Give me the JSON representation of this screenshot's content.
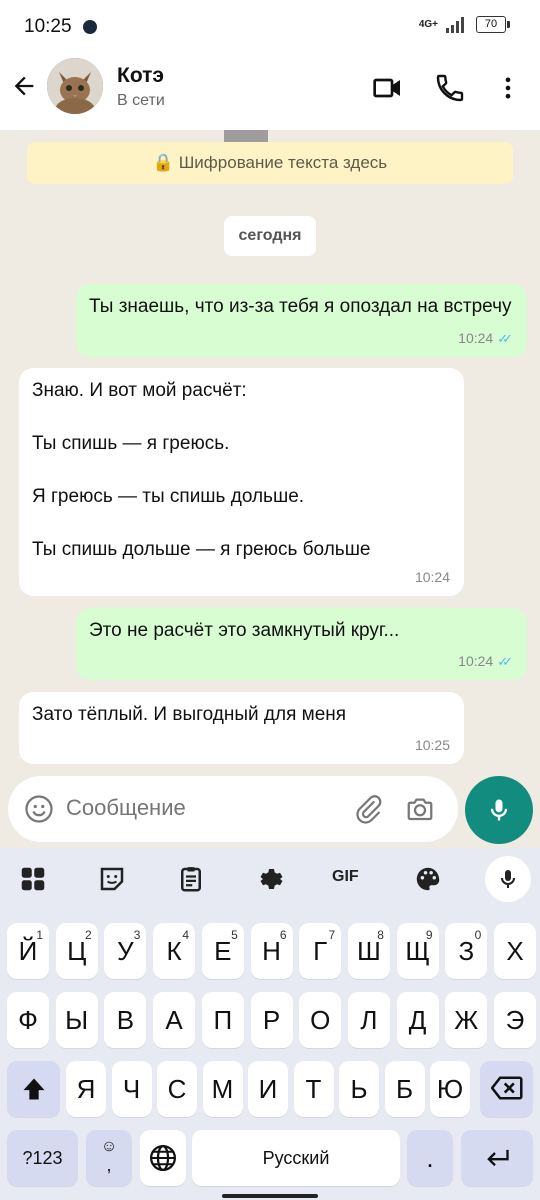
{
  "status_bar": {
    "time": "10:25",
    "network": "4G+",
    "battery": "70"
  },
  "header": {
    "contact_name": "Котэ",
    "contact_status": "В сети"
  },
  "chat": {
    "encryption_note": "🔒 Шифрование текста здесь",
    "date_chip": "сегодня",
    "messages": [
      {
        "direction": "out",
        "text": "Ты знаешь, что из-за тебя я опоздал на встречу",
        "time": "10:24",
        "read": true
      },
      {
        "direction": "in",
        "text": "Знаю. И вот мой расчёт:\n\nТы спишь — я греюсь.\n\nЯ греюсь — ты спишь дольше.\n\nТы спишь дольше — я греюсь больше",
        "time": "10:24"
      },
      {
        "direction": "out",
        "text": "Это не расчёт это замкнутый круг...",
        "time": "10:24",
        "read": true
      },
      {
        "direction": "in",
        "text": "Зато тёплый. И выгодный для меня",
        "time": "10:25"
      }
    ]
  },
  "composer": {
    "placeholder": "Сообщение"
  },
  "keyboard": {
    "toolbar": [
      "apps-icon",
      "sticker-icon",
      "clipboard-icon",
      "settings-icon",
      "GIF",
      "palette-icon",
      "mic-icon"
    ],
    "row1": [
      {
        "k": "Й",
        "n": "1"
      },
      {
        "k": "Ц",
        "n": "2"
      },
      {
        "k": "У",
        "n": "3"
      },
      {
        "k": "К",
        "n": "4"
      },
      {
        "k": "Е",
        "n": "5"
      },
      {
        "k": "Н",
        "n": "6"
      },
      {
        "k": "Г",
        "n": "7"
      },
      {
        "k": "Ш",
        "n": "8"
      },
      {
        "k": "Щ",
        "n": "9"
      },
      {
        "k": "З",
        "n": "0"
      },
      {
        "k": "Х",
        "n": ""
      }
    ],
    "row2": [
      "Ф",
      "Ы",
      "В",
      "А",
      "П",
      "Р",
      "О",
      "Л",
      "Д",
      "Ж",
      "Э"
    ],
    "row3": [
      "Я",
      "Ч",
      "С",
      "М",
      "И",
      "Т",
      "Ь",
      "Б",
      "Ю"
    ],
    "symbols_key": "?123",
    "emoji_comma_key": ",",
    "space_label": "Русский",
    "period_key": "."
  },
  "colors": {
    "accent": "#128c7e",
    "outgoing_bubble": "#d9fdd3",
    "read_ticks": "#53bdeb"
  }
}
